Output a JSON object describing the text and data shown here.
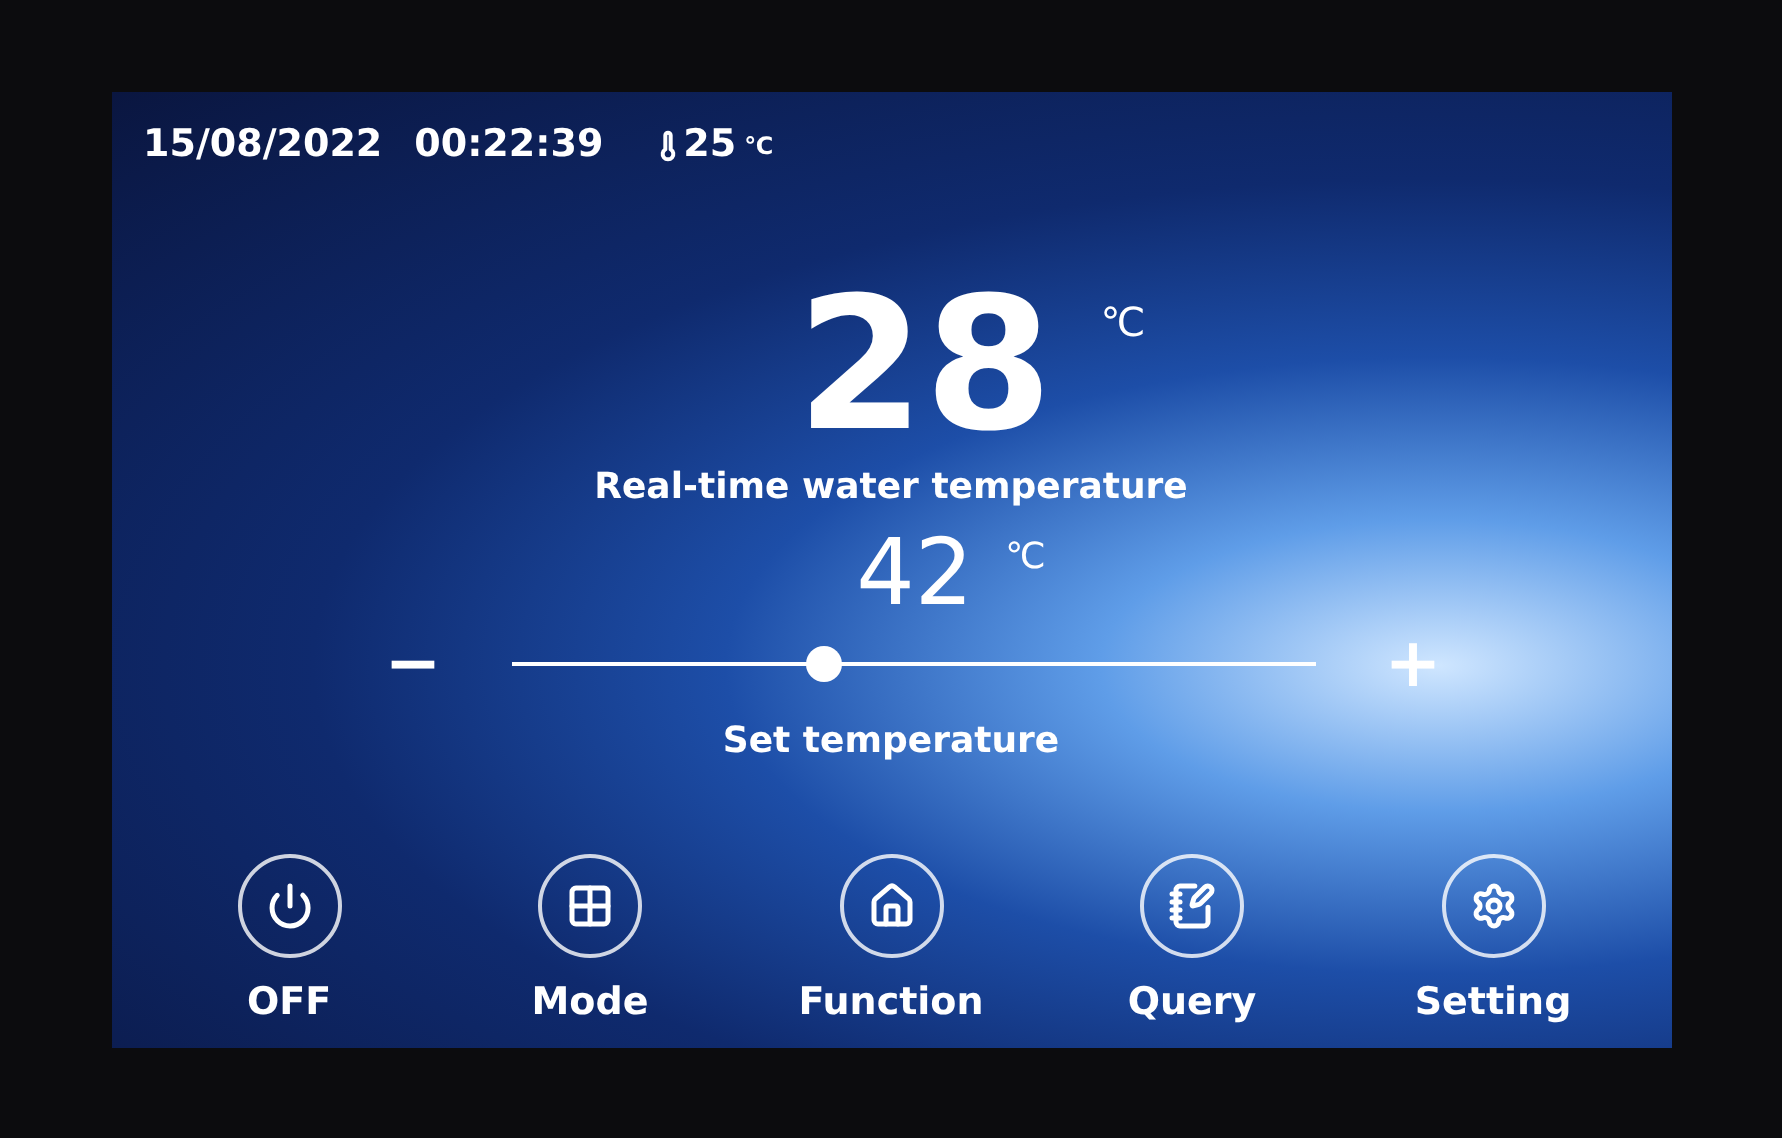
{
  "status_bar": {
    "date": "15/08/2022",
    "time": "00:22:39",
    "ambient_temperature": "25",
    "ambient_unit": "℃"
  },
  "water_temperature": {
    "value": "28",
    "unit": "℃",
    "label": "Real-time water temperature"
  },
  "set_temperature": {
    "value": "42",
    "unit": "℃",
    "minus": "−",
    "plus": "+",
    "level": 0.39,
    "label": "Set temperature"
  },
  "buttons": [
    {
      "kind": "power",
      "label": "OFF"
    },
    {
      "kind": "mode",
      "label": "Mode"
    },
    {
      "kind": "function",
      "label": "Function"
    },
    {
      "kind": "query",
      "label": "Query"
    },
    {
      "kind": "setting",
      "label": "Setting"
    }
  ]
}
